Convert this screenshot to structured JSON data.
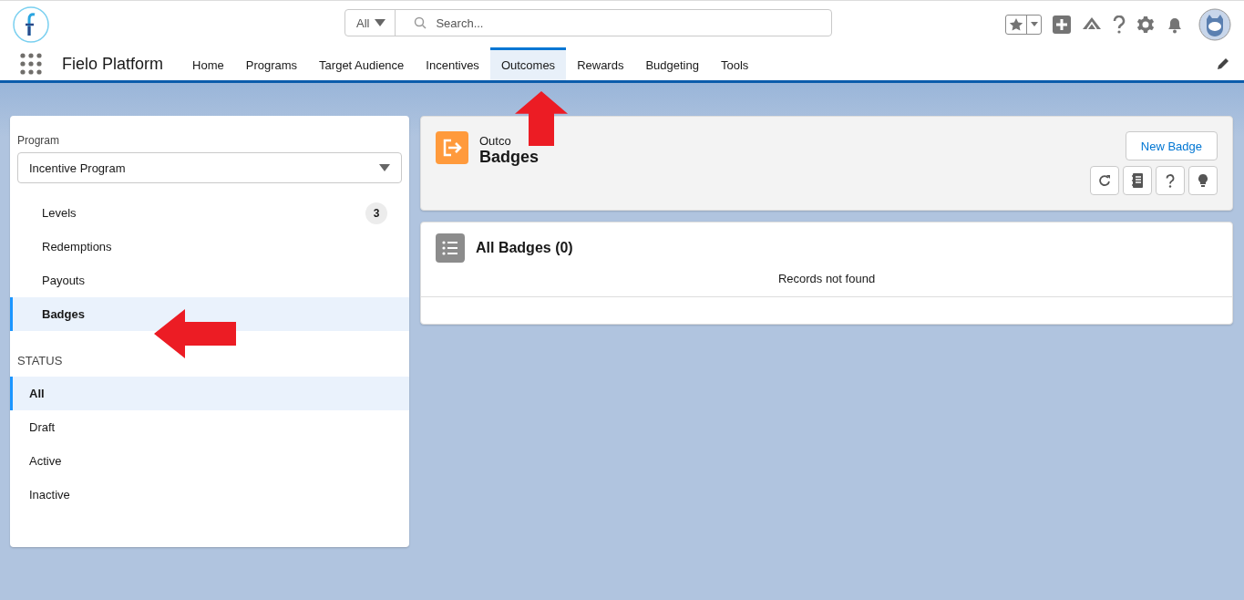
{
  "app": {
    "name": "Fielo Platform"
  },
  "search": {
    "scope": "All",
    "placeholder": "Search..."
  },
  "nav_tabs": [
    {
      "label": "Home",
      "selected": false
    },
    {
      "label": "Programs",
      "selected": false
    },
    {
      "label": "Target Audience",
      "selected": false
    },
    {
      "label": "Incentives",
      "selected": false
    },
    {
      "label": "Outcomes",
      "selected": true
    },
    {
      "label": "Rewards",
      "selected": false
    },
    {
      "label": "Budgeting",
      "selected": false
    },
    {
      "label": "Tools",
      "selected": false
    }
  ],
  "sidebar": {
    "program_label": "Program",
    "program_value": "Incentive Program",
    "items": [
      {
        "label": "Levels",
        "count": "3",
        "selected": false
      },
      {
        "label": "Redemptions",
        "selected": false
      },
      {
        "label": "Payouts",
        "selected": false
      },
      {
        "label": "Badges",
        "selected": true
      }
    ],
    "status_heading": "STATUS",
    "status_items": [
      {
        "label": "All",
        "selected": true
      },
      {
        "label": "Draft",
        "selected": false
      },
      {
        "label": "Active",
        "selected": false
      },
      {
        "label": "Inactive",
        "selected": false
      }
    ]
  },
  "page_header": {
    "object": "Outco",
    "title": "Badges",
    "new_button": "New Badge"
  },
  "list": {
    "title": "All Badges (0)",
    "empty_message": "Records not found"
  }
}
